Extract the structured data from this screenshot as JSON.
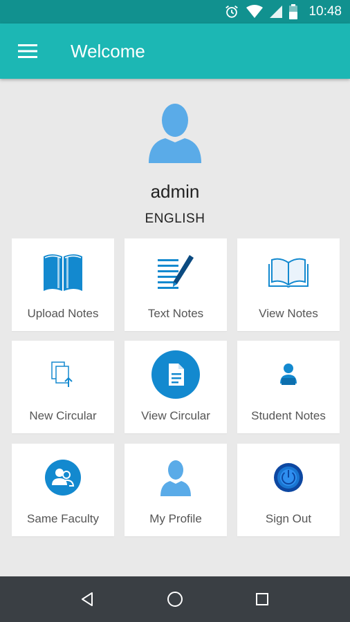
{
  "status_bar": {
    "time": "10:48"
  },
  "app_bar": {
    "title": "Welcome"
  },
  "profile": {
    "name": "admin",
    "language": "ENGLISH"
  },
  "tiles": [
    {
      "label": "Upload Notes",
      "icon": "book-open-icon"
    },
    {
      "label": "Text Notes",
      "icon": "pen-notes-icon"
    },
    {
      "label": "View Notes",
      "icon": "open-book-outline-icon"
    },
    {
      "label": "New Circular",
      "icon": "document-upload-icon"
    },
    {
      "label": "View Circular",
      "icon": "document-circle-icon"
    },
    {
      "label": "Student Notes",
      "icon": "student-icon"
    },
    {
      "label": "Same Faculty",
      "icon": "group-circle-icon"
    },
    {
      "label": "My Profile",
      "icon": "user-icon"
    },
    {
      "label": "Sign Out",
      "icon": "power-icon"
    }
  ],
  "colors": {
    "primary": "#1cb7b4",
    "status": "#11918f",
    "accent": "#1389cf",
    "avatar": "#5aabe8"
  }
}
